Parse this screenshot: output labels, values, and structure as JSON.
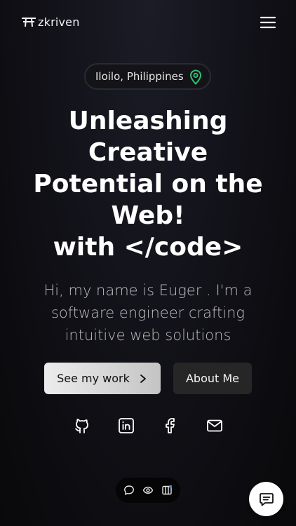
{
  "header": {
    "brand": "zkriven",
    "logo_icon": "pi-logo-icon",
    "menu_icon": "hamburger-menu-icon"
  },
  "location": {
    "text": "Iloilo, Philippines",
    "icon": "map-pin-icon",
    "icon_color": "#2fbf71"
  },
  "hero": {
    "title_lines": [
      "Unleashing",
      "Creative",
      "Potential on the",
      "Web!",
      "with </code>"
    ],
    "subtitle": "Hi, my name is Euger . I'm a software engineer crafting intuitive web solutions"
  },
  "buttons": {
    "see_work": "See my work",
    "about": "About Me"
  },
  "socials": [
    {
      "icon": "github-icon"
    },
    {
      "icon": "linkedin-icon"
    },
    {
      "icon": "facebook-icon"
    },
    {
      "icon": "mail-icon"
    }
  ],
  "toolbar": {
    "icons": [
      "comment-icon",
      "eye-icon",
      "panel-icon"
    ],
    "notification_color": "#3b82f6"
  },
  "chat_button": {
    "icon": "chat-icon"
  },
  "colors": {
    "background": "#101016",
    "accent_green": "#2fbf71",
    "text_muted": "#bdbdbd"
  }
}
